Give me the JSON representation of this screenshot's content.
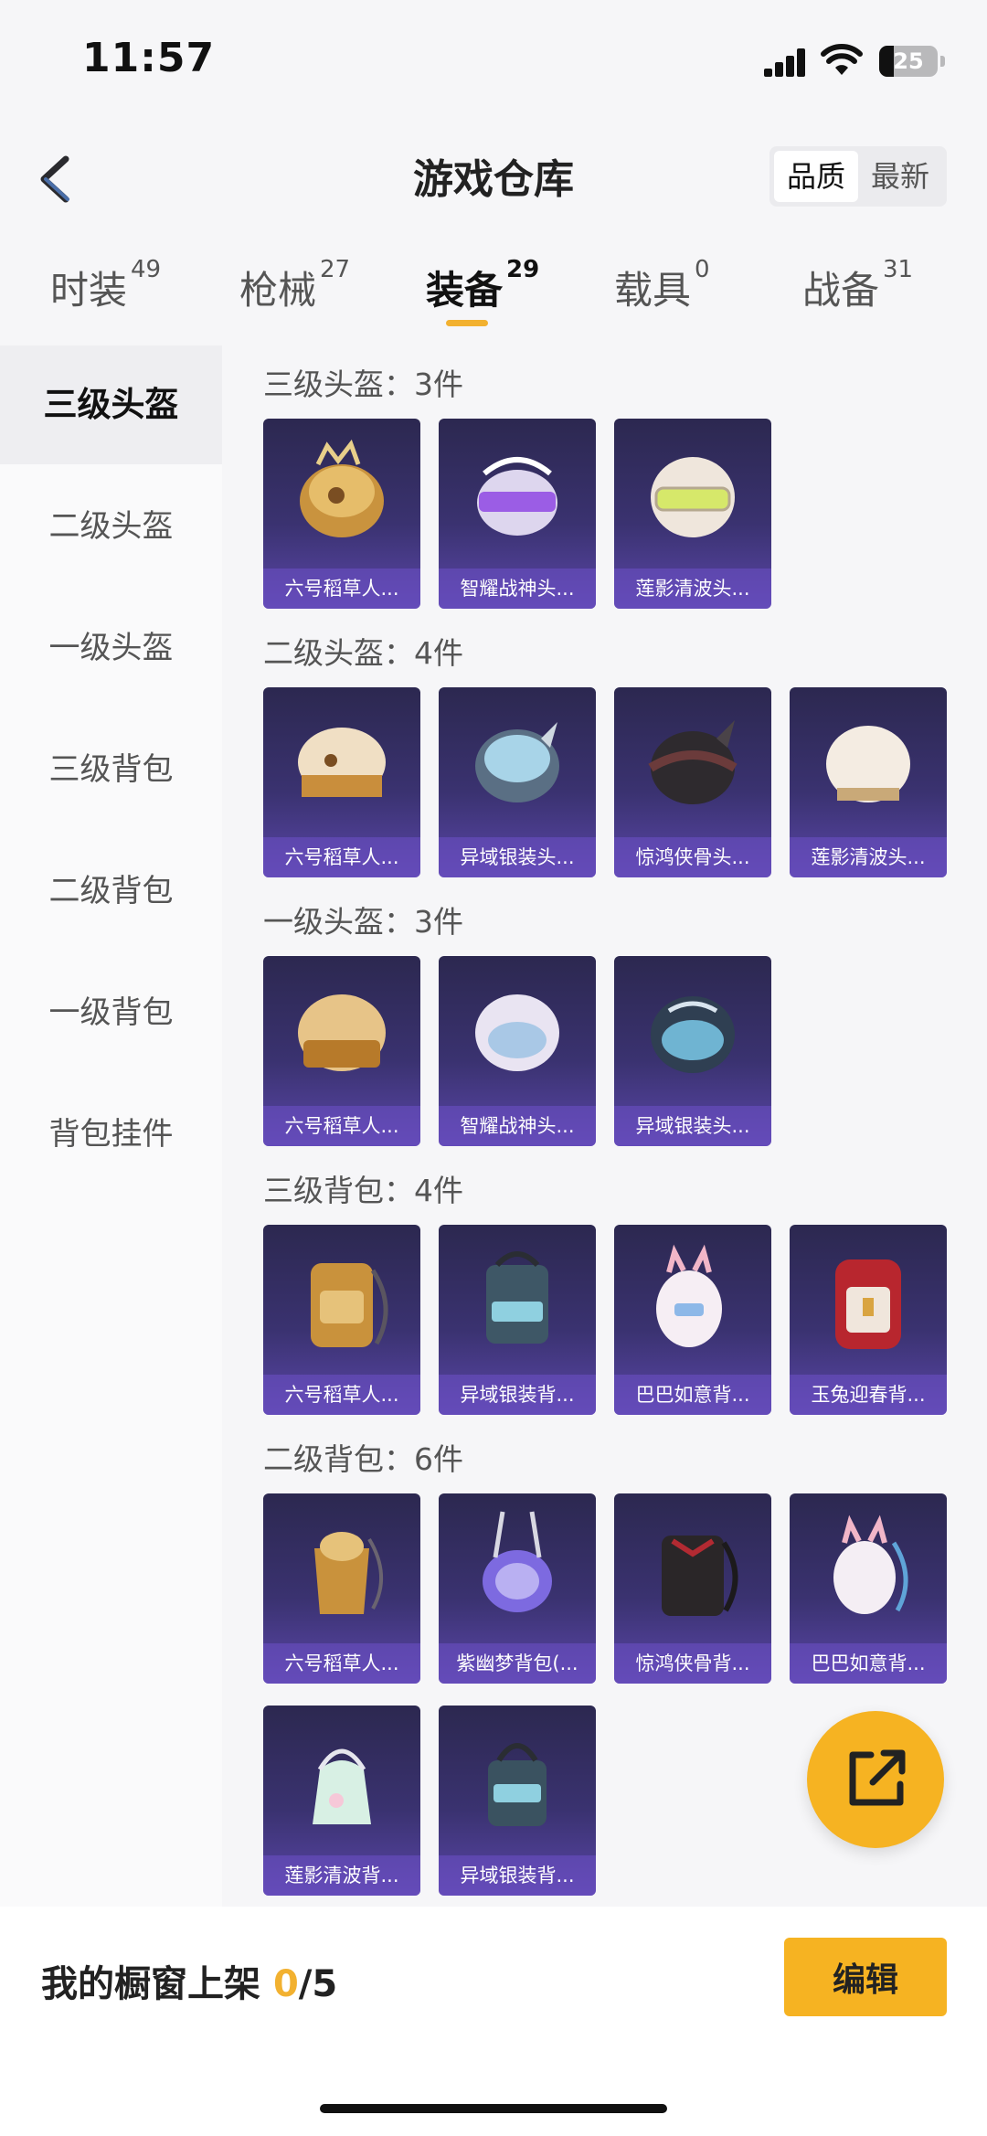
{
  "status_bar": {
    "time": "11:57",
    "battery": "25"
  },
  "header": {
    "title": "游戏仓库",
    "sort_options": [
      "品质",
      "最新"
    ]
  },
  "tabs": [
    {
      "label": "时装",
      "count": "49"
    },
    {
      "label": "枪械",
      "count": "27"
    },
    {
      "label": "装备",
      "count": "29"
    },
    {
      "label": "载具",
      "count": "0"
    },
    {
      "label": "战备",
      "count": "31"
    }
  ],
  "sidebar": {
    "items": [
      "三级头盔",
      "二级头盔",
      "一级头盔",
      "三级背包",
      "二级背包",
      "一级背包",
      "背包挂件"
    ]
  },
  "sections": [
    {
      "title": "三级头盔：3件",
      "items": [
        "六号稻草人...",
        "智耀战神头...",
        "莲影清波头..."
      ]
    },
    {
      "title": "二级头盔：4件",
      "items": [
        "六号稻草人...",
        "异域银装头...",
        "惊鸿侠骨头...",
        "莲影清波头..."
      ]
    },
    {
      "title": "一级头盔：3件",
      "items": [
        "六号稻草人...",
        "智耀战神头...",
        "异域银装头..."
      ]
    },
    {
      "title": "三级背包：4件",
      "items": [
        "六号稻草人...",
        "异域银装背...",
        "巴巴如意背...",
        "玉兔迎春背..."
      ]
    },
    {
      "title": "二级背包：6件",
      "items": [
        "六号稻草人...",
        "紫幽梦背包(...",
        "惊鸿侠骨背...",
        "巴巴如意背...",
        "莲影清波背...",
        "异域银装背..."
      ]
    }
  ],
  "bottom": {
    "showcase_label": "我的橱窗上架",
    "showcase_count": "0",
    "showcase_total": "/5",
    "edit_button": "编辑"
  },
  "colors": {
    "accent": "#f6b322",
    "card_bg": "#3a3270",
    "tab_underline": "#f2b130"
  }
}
